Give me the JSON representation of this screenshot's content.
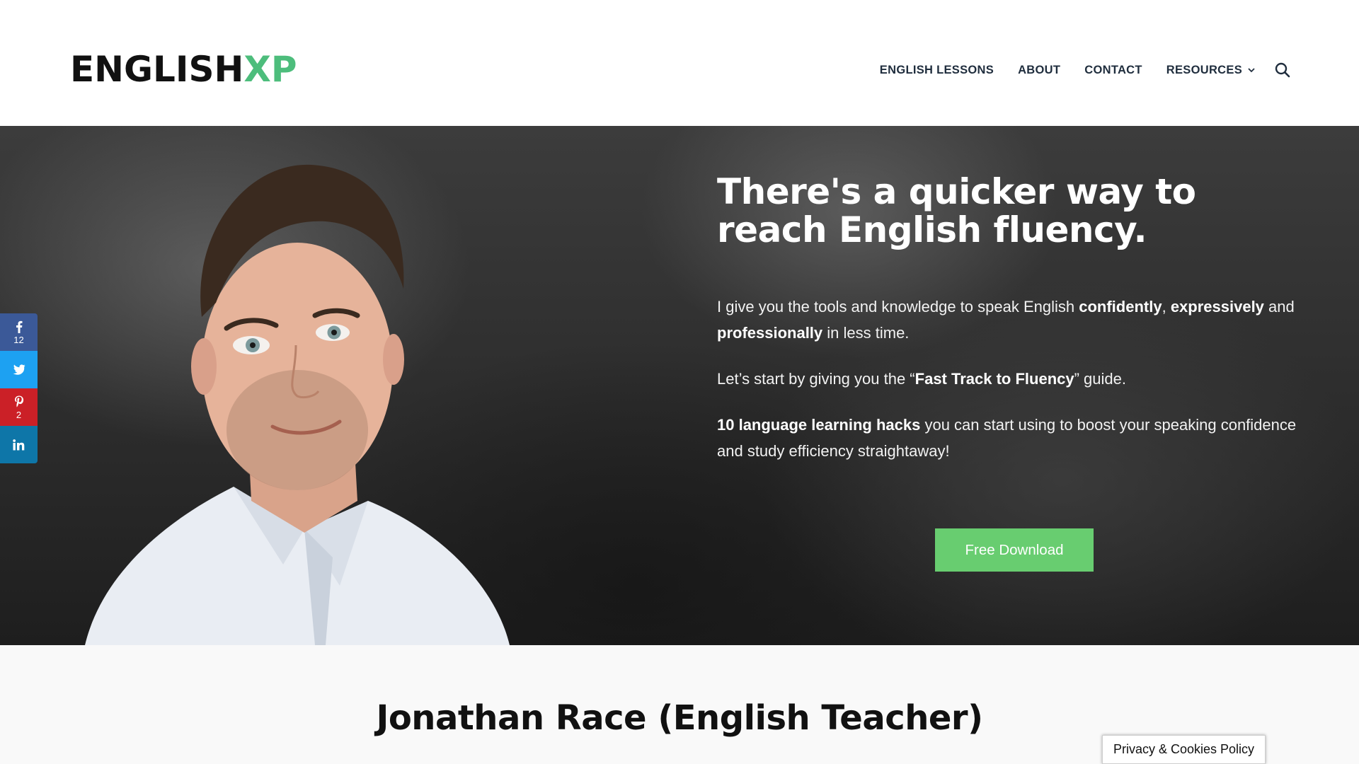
{
  "header": {
    "logo_main": "ENGLISH",
    "logo_accent": "XP",
    "nav": [
      {
        "label": "ENGLISH LESSONS"
      },
      {
        "label": "ABOUT"
      },
      {
        "label": "CONTACT"
      },
      {
        "label": "RESOURCES"
      }
    ],
    "icons": {
      "resources_dropdown": "chevron-down-icon",
      "search": "search-icon"
    }
  },
  "hero": {
    "title": "There's a quicker way to reach English fluency.",
    "p1_a": "I give you the tools and knowledge to speak English ",
    "p1_b1": "confidently",
    "p1_c": ", ",
    "p1_b2": "expressively",
    "p1_d": " and ",
    "p1_b3": "professionally",
    "p1_e": " in less time.",
    "p2_a": "Let’s start by giving you the “",
    "p2_b": "Fast Track to Fluency",
    "p2_c": "” guide.",
    "p3_b": "10 language learning hacks",
    "p3_a": " you can start using to boost your speaking confidence and study efficiency straightaway!",
    "cta_label": "Free Download"
  },
  "share": [
    {
      "network": "facebook",
      "icon": "facebook-icon",
      "count": "12",
      "color": "#3b5998"
    },
    {
      "network": "twitter",
      "icon": "twitter-icon",
      "count": "",
      "color": "#1da1f2"
    },
    {
      "network": "pinterest",
      "icon": "pinterest-icon",
      "count": "2",
      "color": "#cb2027"
    },
    {
      "network": "linkedin",
      "icon": "linkedin-icon",
      "count": "",
      "color": "#0e76a8"
    }
  ],
  "about": {
    "title": "Jonathan Race (English Teacher)"
  },
  "cookie": {
    "label": "Privacy & Cookies Policy"
  },
  "colors": {
    "accent": "#4dbd7c",
    "cta": "#68cd70"
  }
}
